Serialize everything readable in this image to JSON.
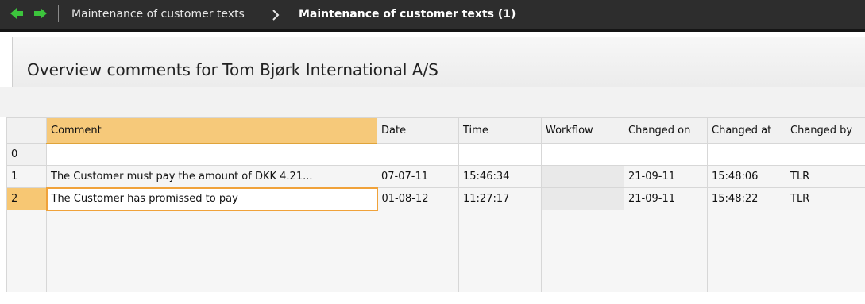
{
  "nav": {
    "breadcrumb": [
      "Maintenance of customer texts",
      "Maintenance of customer texts (1)"
    ],
    "colors": {
      "arrow": "#3cc43c",
      "bar": "#2d2d2d"
    }
  },
  "panel": {
    "title": "Overview comments for Tom Bjørk International A/S",
    "accent": "#1f2f8c"
  },
  "grid": {
    "columns": [
      "Comment",
      "Date",
      "Time",
      "Workflow",
      "Changed on",
      "Changed at",
      "Changed by"
    ],
    "rows": [
      {
        "num": "0",
        "comment": "",
        "date": "",
        "time": "",
        "workflow": "",
        "changed_on": "",
        "changed_at": "",
        "changed_by": ""
      },
      {
        "num": "1",
        "comment": "The Customer must pay the amount of DKK 4.21...",
        "date": "07-07-11",
        "time": "15:46:34",
        "workflow": "",
        "changed_on": "21-09-11",
        "changed_at": "15:48:06",
        "changed_by": "TLR"
      },
      {
        "num": "2",
        "comment": "The Customer has promissed to pay",
        "date": "01-08-12",
        "time": "11:27:17",
        "workflow": "",
        "changed_on": "21-09-11",
        "changed_at": "15:48:22",
        "changed_by": "TLR"
      }
    ],
    "selected_row": "2",
    "sorted_column": "Comment"
  }
}
